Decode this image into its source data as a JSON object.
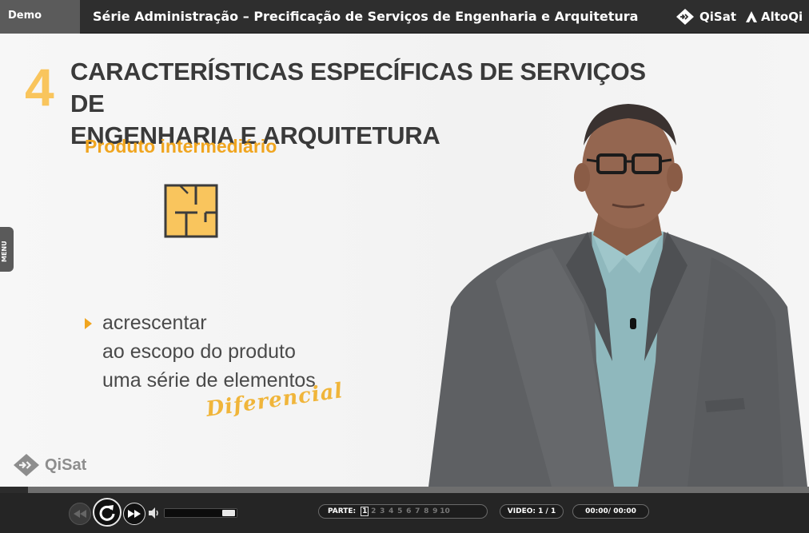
{
  "header": {
    "demo_label": "Demo",
    "course_title": "Série Administração – Precificação de Serviços de Engenharia e Arquitetura",
    "brand_qisat": "QiSat",
    "brand_altoqi": "AltoQi"
  },
  "slide": {
    "section_number": "4",
    "heading_line1": "CARACTERÍSTICAS ESPECÍFICAS DE SERVIÇOS DE",
    "heading_line2": "ENGENHARIA E ARQUITETURA",
    "subheading": "Produto intermediário",
    "icon": "floorplan-icon",
    "bullet_lines": [
      "acrescentar",
      "ao escopo do produto",
      "uma série de elementos"
    ],
    "highlight": "Diferencial",
    "watermark": "QiSat"
  },
  "sidebar": {
    "menu_label": "MENU"
  },
  "player": {
    "progress_fraction": 0.035,
    "volume_fraction": 1.0,
    "parts_label": "PARTE:",
    "parts": [
      "1",
      "2",
      "3",
      "4",
      "5",
      "6",
      "7",
      "8",
      "9",
      "10"
    ],
    "active_part": "1",
    "video_label": "VIDEO:",
    "video_value": "1 / 1",
    "time": "00:00/ 00:00"
  },
  "colors": {
    "accent": "#f0a51f",
    "number": "#f9c55d",
    "header_bg": "#2e2e2e",
    "controls_bg": "#252525"
  }
}
